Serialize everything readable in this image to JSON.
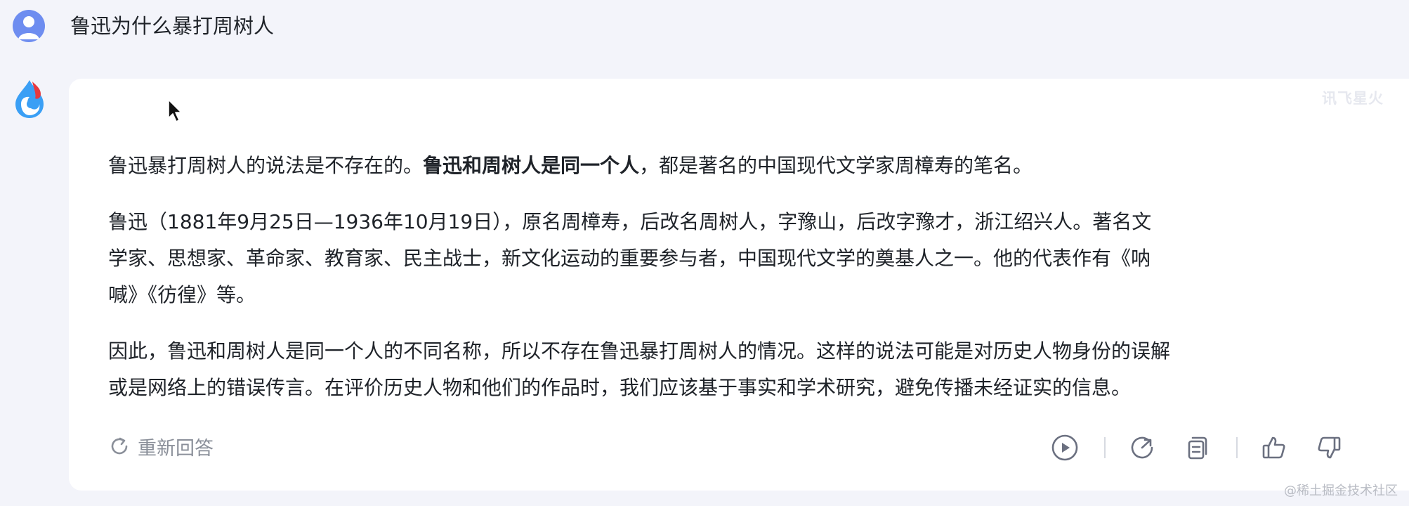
{
  "user": {
    "question": "鲁迅为什么暴打周树人"
  },
  "assistant": {
    "brand_watermark": "讯飞星火",
    "paragraph1": {
      "part1": "鲁迅暴打周树人的说法是不存在的。",
      "bold": "鲁迅和周树人是同一个人",
      "part2": "，都是著名的中国现代文学家周樟寿的笔名。"
    },
    "paragraph2": {
      "lines": [
        "鲁迅（1881年9月25日—1936年10月19日），原名周樟寿，后改名周树人，字豫山，后改字豫才，浙江绍兴人。著名文",
        "学家、思想家、革命家、教育家、民主战士，新文化运动的重要参与者，中国现代文学的奠基人之一。他的代表作有《呐",
        "喊》《彷徨》等。"
      ]
    },
    "paragraph3": {
      "lines": [
        "因此，鲁迅和周树人是同一个人的不同名称，所以不存在鲁迅暴打周树人的情况。这样的说法可能是对历史人物身份的误解",
        "或是网络上的错误传言。在评价历史人物和他们的作品时，我们应该基于事实和学术研究，避免传播未经证实的信息。"
      ]
    }
  },
  "actions": {
    "regenerate_label": "重新回答",
    "icons": [
      "play-icon",
      "share-icon",
      "copy-icon",
      "thumbs-up-icon",
      "thumbs-down-icon"
    ]
  },
  "footer": {
    "watermark": "@稀土掘金技术社区"
  },
  "colors": {
    "background": "#f3f4fa",
    "card": "#ffffff",
    "text": "#1f2329",
    "muted": "#8a8f99",
    "avatar": "#6e8df0",
    "logo_blue": "#3a9ff5",
    "logo_red": "#e8383d"
  }
}
